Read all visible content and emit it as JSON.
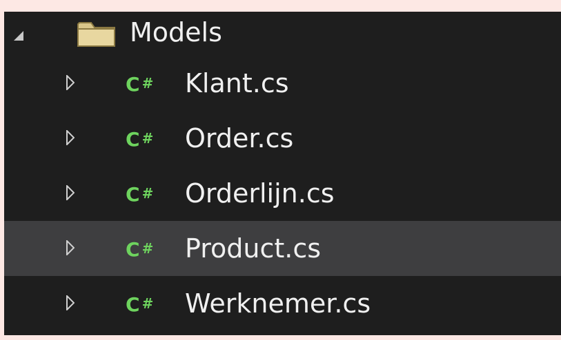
{
  "tree": {
    "folder": {
      "label": "Models",
      "icon": "folder-icon",
      "expanded": true
    },
    "files": [
      {
        "icon_text": "C",
        "icon_hash": "#",
        "label": "Klant.cs",
        "selected": false
      },
      {
        "icon_text": "C",
        "icon_hash": "#",
        "label": "Order.cs",
        "selected": false
      },
      {
        "icon_text": "C",
        "icon_hash": "#",
        "label": "Orderlijn.cs",
        "selected": false
      },
      {
        "icon_text": "C",
        "icon_hash": "#",
        "label": "Product.cs",
        "selected": true
      },
      {
        "icon_text": "C",
        "icon_hash": "#",
        "label": "Werknemer.cs",
        "selected": false
      }
    ]
  },
  "colors": {
    "background_outer": "#fde8e4",
    "background_panel": "#1e1e1e",
    "selection": "#3e3e40",
    "text": "#f0f0f0",
    "csharp_icon": "#6ed35e",
    "folder_icon": "#d9c68a"
  }
}
